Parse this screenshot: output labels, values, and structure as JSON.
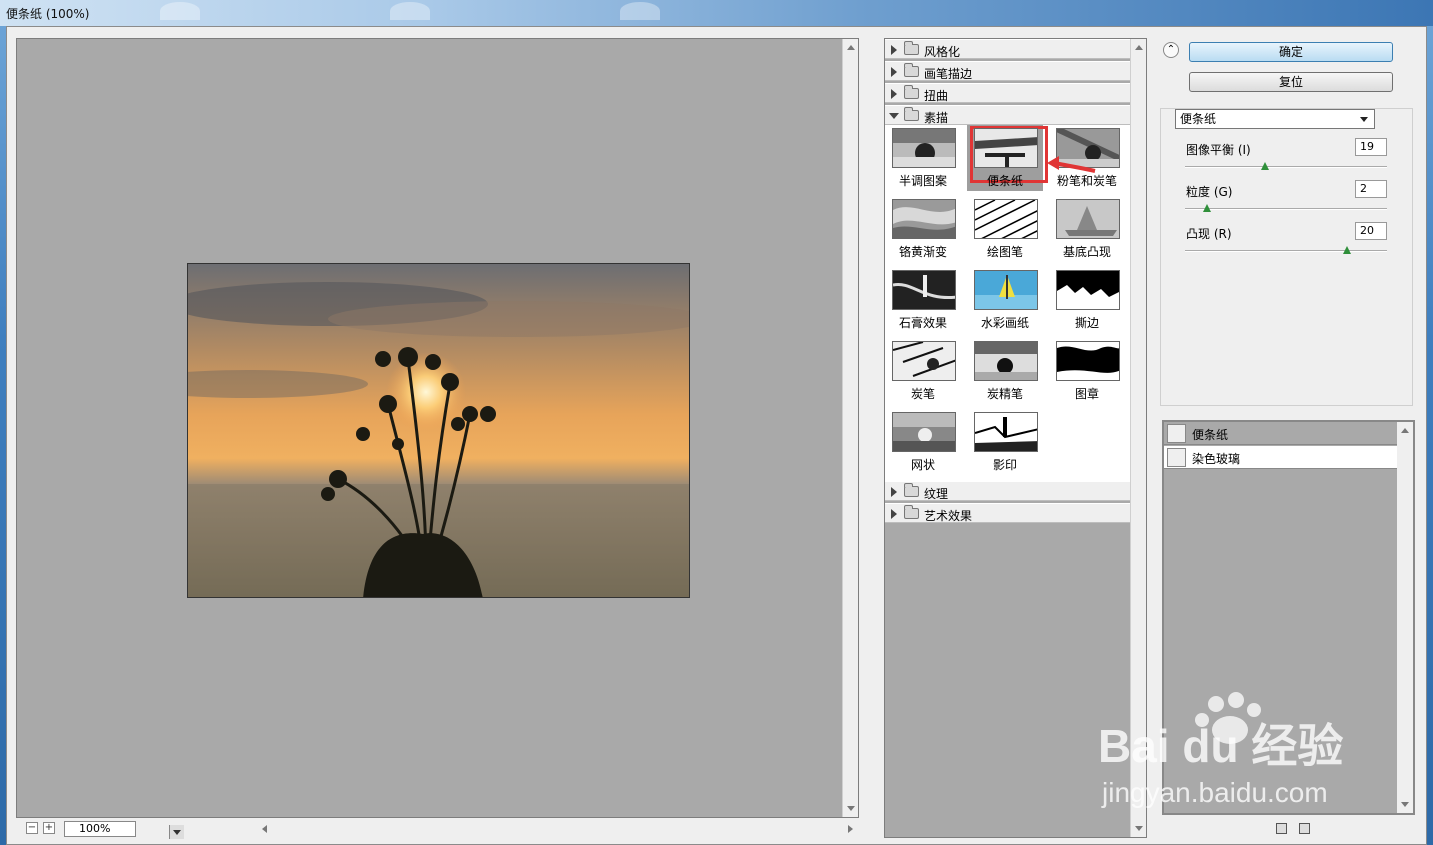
{
  "window": {
    "title": "便条纸 (100%)"
  },
  "preview": {
    "zoom": "100%"
  },
  "gallery": {
    "categories_top": [
      "风格化",
      "画笔描边",
      "扭曲",
      "素描"
    ],
    "categories_bottom": [
      "纹理",
      "艺术效果"
    ],
    "open_category": "素描",
    "thumbs": [
      {
        "label": "半调图案",
        "icon": "halftone-thumb"
      },
      {
        "label": "便条纸",
        "icon": "note-paper-thumb",
        "selected": true
      },
      {
        "label": "粉笔和炭笔",
        "icon": "chalk-charcoal-thumb"
      },
      {
        "label": "铬黄渐变",
        "icon": "chrome-thumb"
      },
      {
        "label": "绘图笔",
        "icon": "graphic-pen-thumb"
      },
      {
        "label": "基底凸现",
        "icon": "bas-relief-thumb"
      },
      {
        "label": "石膏效果",
        "icon": "plaster-thumb"
      },
      {
        "label": "水彩画纸",
        "icon": "water-paper-thumb"
      },
      {
        "label": "撕边",
        "icon": "torn-edges-thumb"
      },
      {
        "label": "炭笔",
        "icon": "charcoal-thumb"
      },
      {
        "label": "炭精笔",
        "icon": "conte-crayon-thumb"
      },
      {
        "label": "图章",
        "icon": "stamp-thumb"
      },
      {
        "label": "网状",
        "icon": "reticulation-thumb"
      },
      {
        "label": "影印",
        "icon": "photocopy-thumb"
      }
    ]
  },
  "right": {
    "ok_label": "确定",
    "reset_label": "复位",
    "filter_select": "便条纸",
    "params": [
      {
        "label": "图像平衡 (I)",
        "value": "19",
        "fraction": 0.4
      },
      {
        "label": "粒度 (G)",
        "value": "2",
        "fraction": 0.1
      },
      {
        "label": "凸现 (R)",
        "value": "20",
        "fraction": 0.8
      }
    ],
    "layers": [
      "便条纸",
      "染色玻璃"
    ]
  },
  "watermark": {
    "brand": "Bai du 经验",
    "url": "jingyan.baidu.com"
  },
  "colors": {
    "highlight": "#e03535",
    "primary_button": "#b9dcf2",
    "canvas_gray": "#a9a9a9"
  }
}
